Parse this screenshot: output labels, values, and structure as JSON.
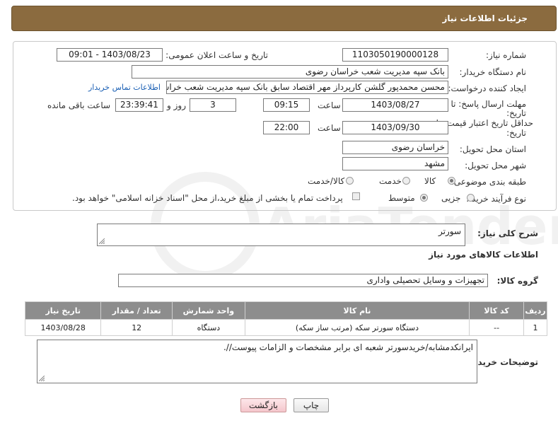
{
  "header": {
    "title": "جزئیات اطلاعات نیاز"
  },
  "form": {
    "need_number": {
      "label": "شماره نیاز:",
      "value": "1103050190000128"
    },
    "announce_datetime": {
      "label": "تاریخ و ساعت اعلان عمومی:",
      "value": "1403/08/23 - 09:01"
    },
    "buyer_org": {
      "label": "نام دستگاه خریدار:",
      "value": "بانک سپه مدیریت شعب خراسان رضوی"
    },
    "requester": {
      "label": "ایجاد کننده درخواست:",
      "value": "محسن محمدپور گلشن کارپرداز مهر اقتصاد سابق بانک سپه مدیریت شعب خراسان",
      "contact_link": "اطلاعات تماس خریدار"
    },
    "reply_deadline": {
      "label_line1": "مهلت ارسال پاسخ: تا",
      "label_line2": "تاریخ:",
      "date": "1403/08/27",
      "time_label": "ساعت",
      "time": "09:15",
      "days": "3",
      "days_label": "روز و",
      "remaining": "23:39:41",
      "remaining_label": "ساعت باقی مانده"
    },
    "price_validity": {
      "label_line1": "حداقل تاریخ اعتبار قیمت: تا",
      "label_line2": "تاریخ:",
      "date": "1403/09/30",
      "time_label": "ساعت",
      "time": "22:00"
    },
    "province": {
      "label": "استان محل تحویل:",
      "value": "خراسان رضوی"
    },
    "city": {
      "label": "شهر محل تحویل:",
      "value": "مشهد"
    },
    "category": {
      "label": "طبقه بندی موضوعی:",
      "options": [
        "کالا",
        "خدمت",
        "کالا/خدمت"
      ],
      "selected": "کالا"
    },
    "process_type": {
      "label": "نوع فرآیند خرید :",
      "options": [
        "جزیی",
        "متوسط"
      ],
      "selected": "متوسط",
      "payment_note": "پرداخت تمام یا بخشی از مبلغ خرید،از محل \"اسناد خزانه اسلامی\" خواهد بود."
    }
  },
  "summary": {
    "label": "شرح کلی نیاز:",
    "value": "سورتر"
  },
  "goods_section": {
    "title": "اطلاعات کالاهای مورد نیاز"
  },
  "goods_group": {
    "label": "گروه کالا:",
    "value": "تجهیزات و وسایل تحصیلی واداری"
  },
  "table": {
    "headers": [
      "ردیف",
      "کد کالا",
      "نام کالا",
      "واحد شمارش",
      "تعداد / مقدار",
      "تاریخ نیاز"
    ],
    "rows": [
      [
        "1",
        "--",
        "دستگاه سورتر سکه (مرتب ساز سکه)",
        "دستگاه",
        "12",
        "1403/08/28"
      ]
    ]
  },
  "buyer_notes": {
    "label": "توضیحات خریدار:",
    "value": "ایرانکدمشابه/خریدسورتر شعبه ای برابر مشخصات و الزامات پیوست//."
  },
  "buttons": {
    "print": "چاپ",
    "back": "بازگشت"
  },
  "watermark": {
    "text": "AriaTender.net"
  }
}
